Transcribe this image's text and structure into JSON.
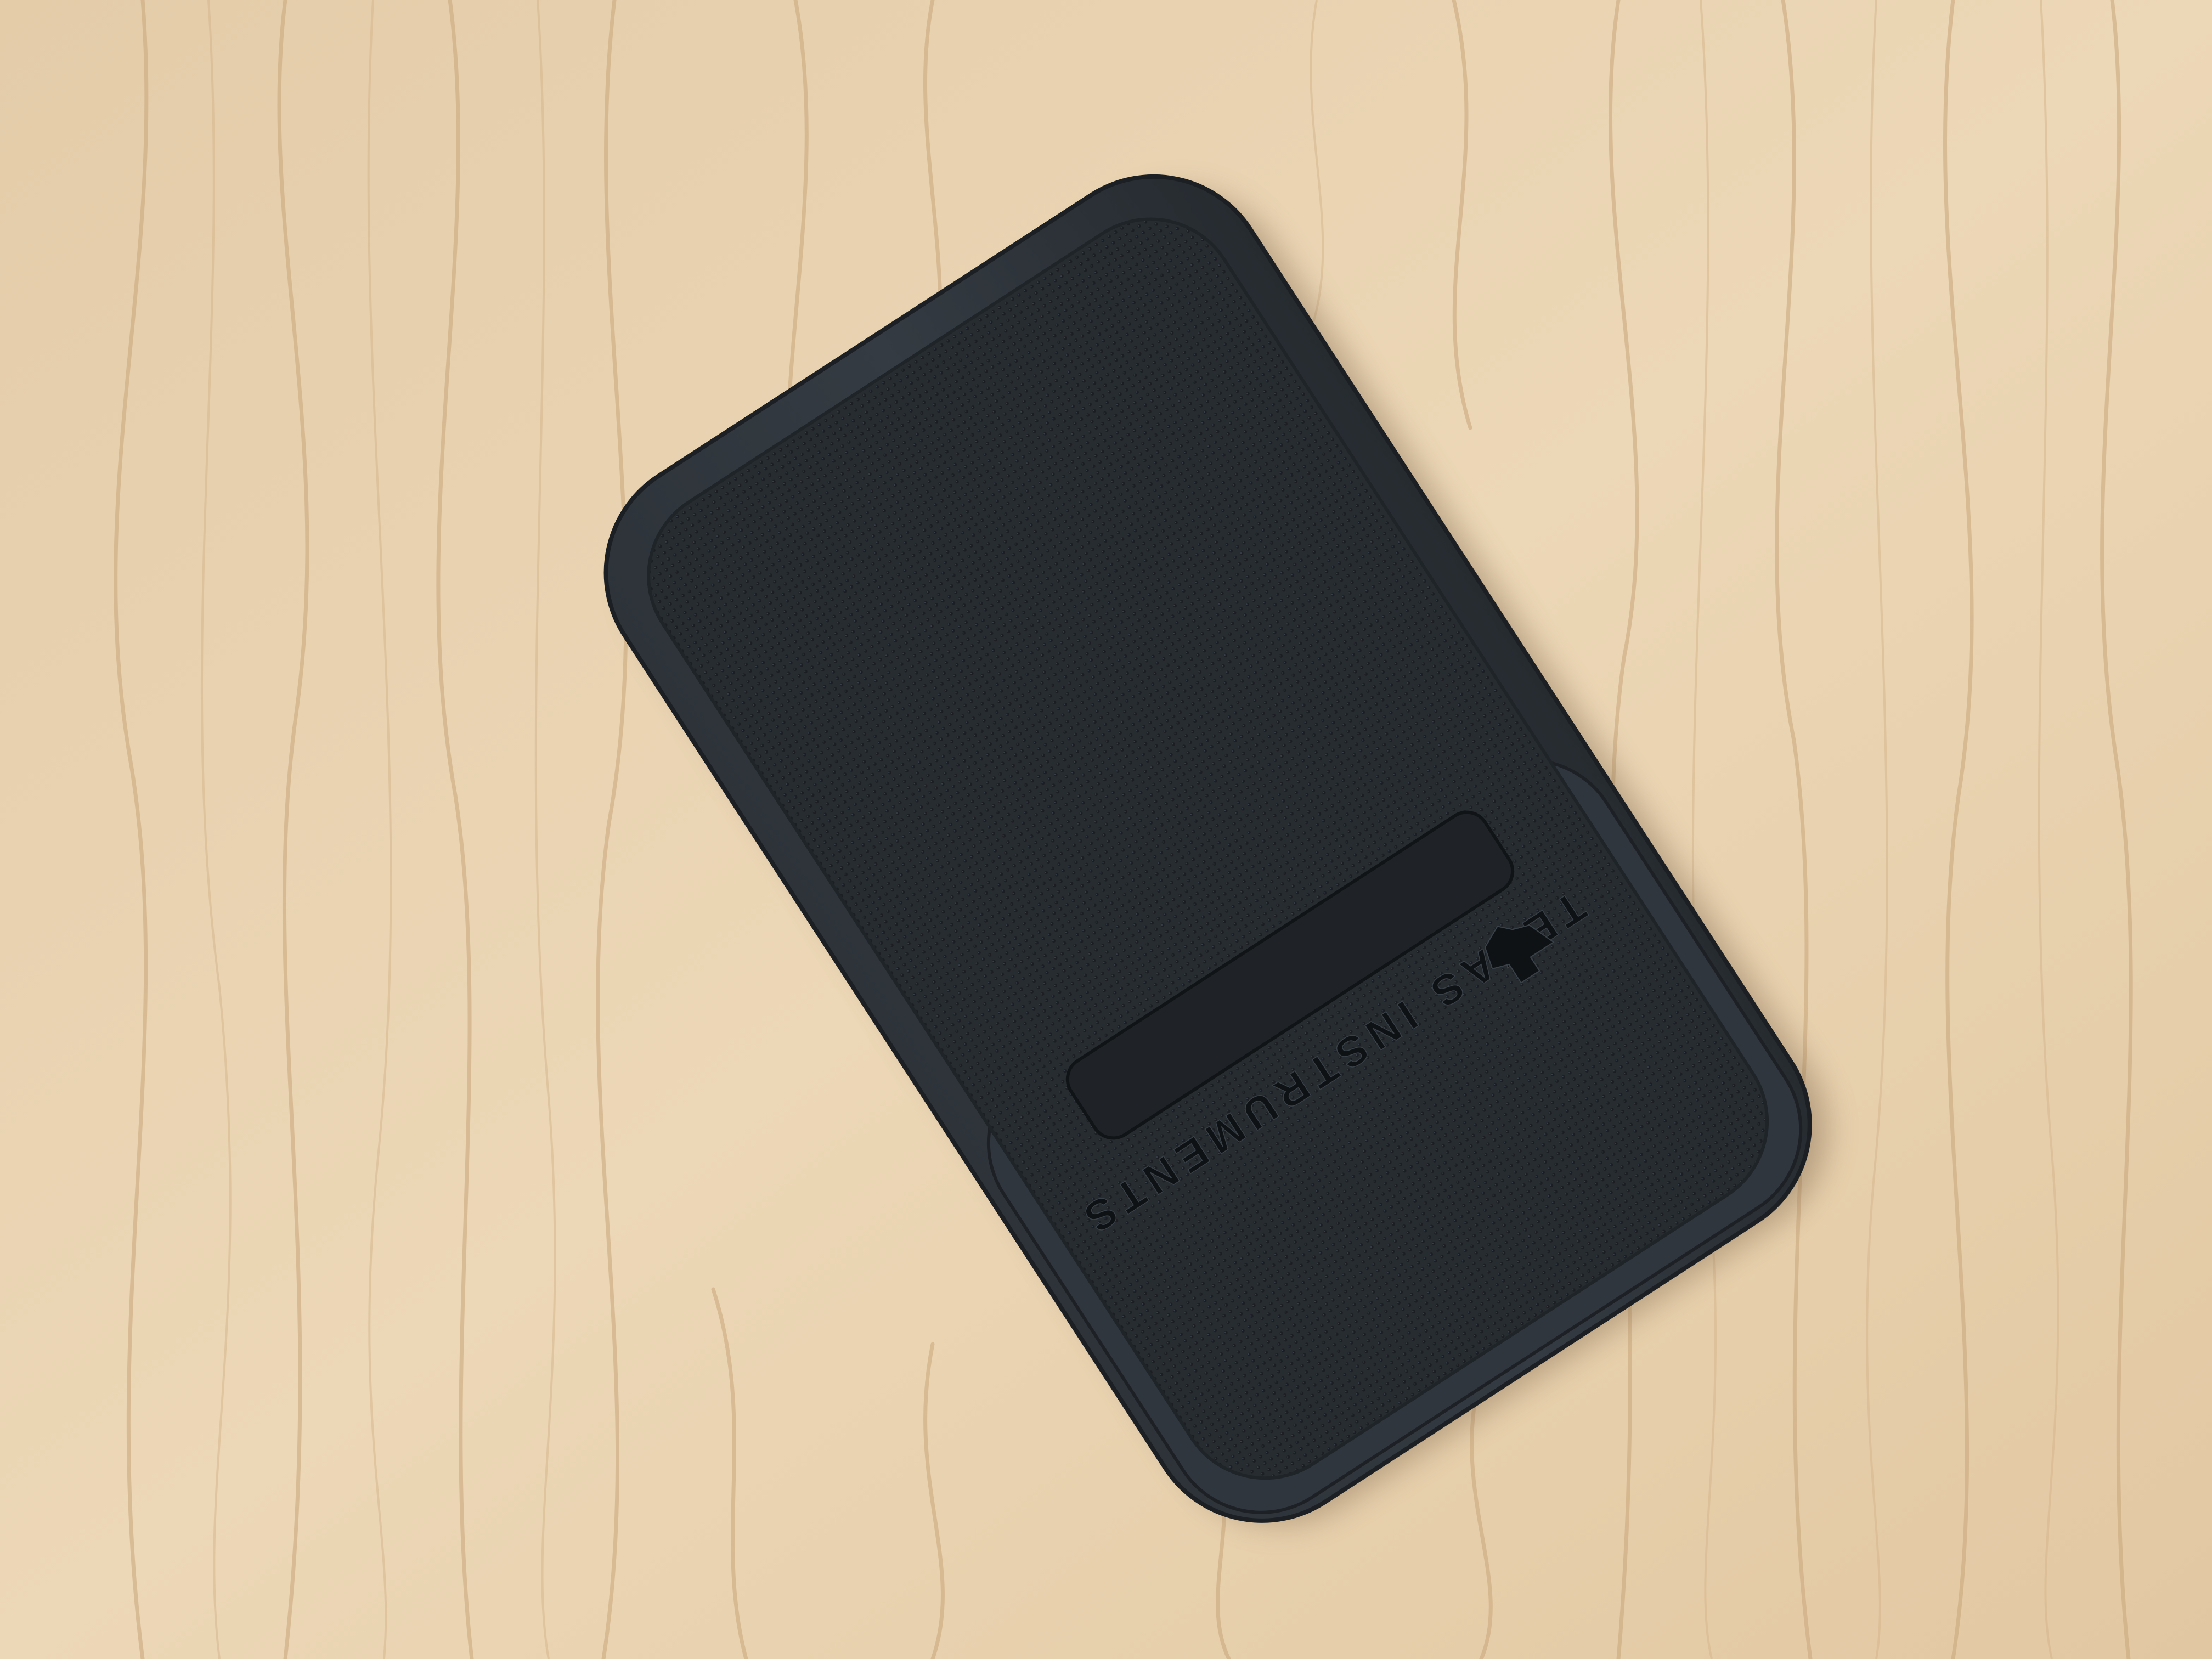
{
  "scene": {
    "subject": "calculator-slide-cover",
    "surface": "wood-table",
    "colors": {
      "wood_light": "#ecd6b4",
      "wood_mid": "#dcc29c",
      "wood_grain": "#c9a57a",
      "cover_dark": "#23272c",
      "cover_mid": "#2e343a",
      "cover_edge": "#3c444c",
      "label_plate": "#1e2226",
      "embossed_text": "#0f1215"
    }
  },
  "cover": {
    "brand_text": "TEXAS INSTRUMENTS",
    "logo_icon": "ti-texas-logo-icon"
  }
}
